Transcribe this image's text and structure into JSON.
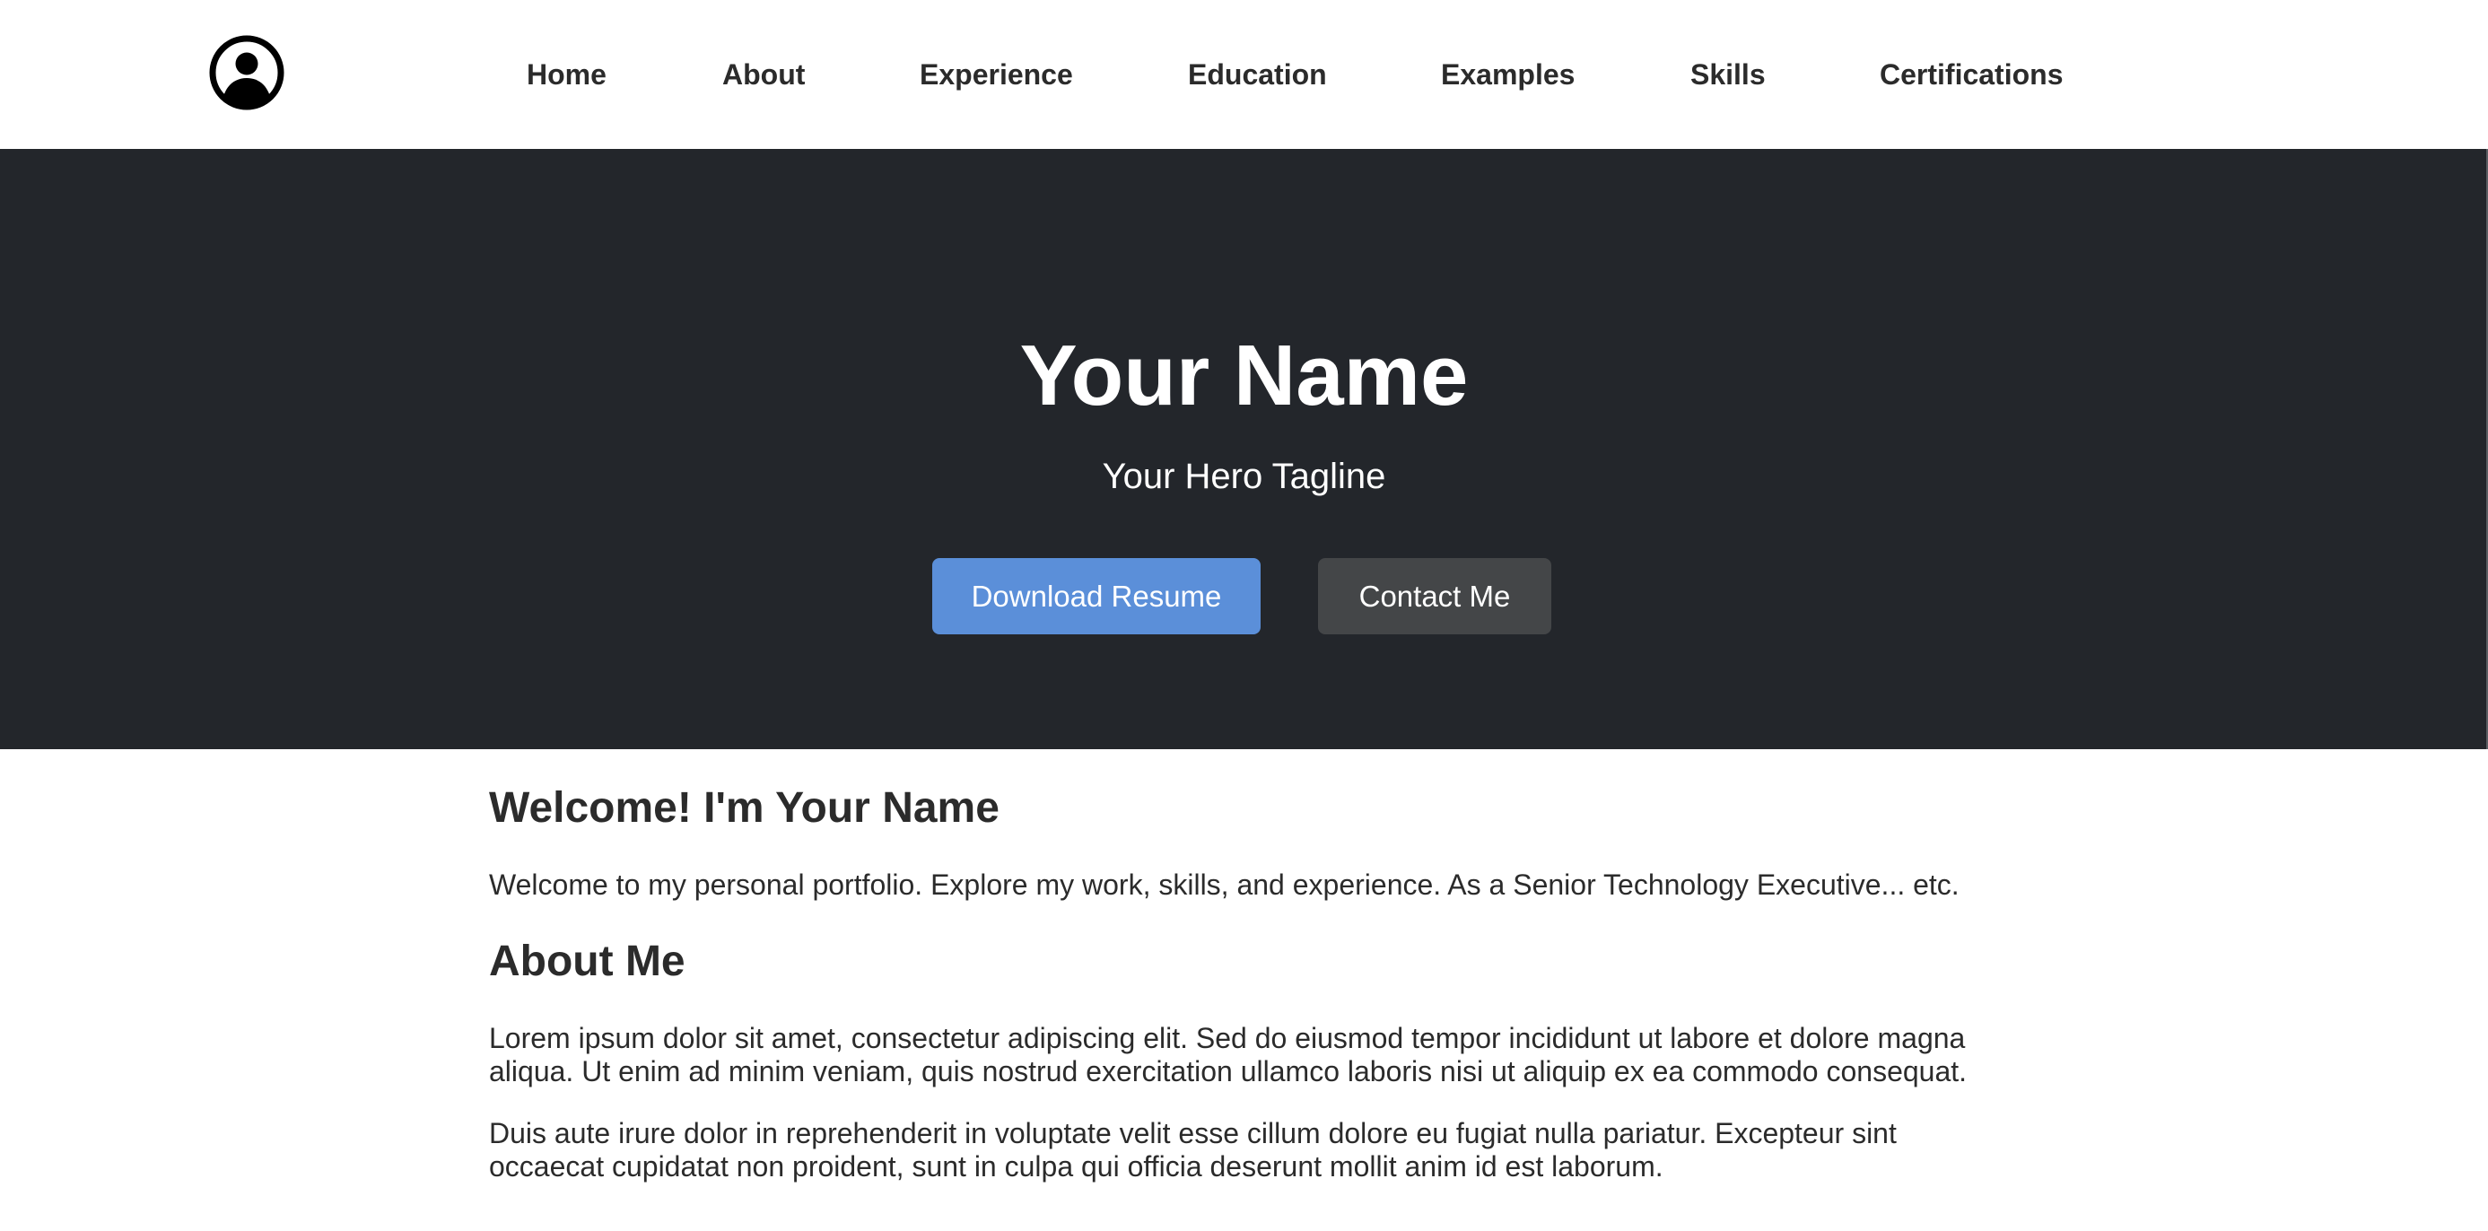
{
  "nav": {
    "logo_icon": "user-avatar-icon",
    "items": [
      {
        "label": "Home"
      },
      {
        "label": "About"
      },
      {
        "label": "Experience"
      },
      {
        "label": "Education"
      },
      {
        "label": "Examples"
      },
      {
        "label": "Skills"
      },
      {
        "label": "Certifications"
      }
    ]
  },
  "hero": {
    "title": "Your Name",
    "tagline": "Your Hero Tagline",
    "primary_button": "Download Resume",
    "secondary_button": "Contact Me"
  },
  "welcome": {
    "heading": "Welcome! I'm Your Name",
    "text": "Welcome to my personal portfolio. Explore my work, skills, and experience. As a Senior Technology Executive... etc."
  },
  "about": {
    "heading": "About Me",
    "paragraphs": [
      "Lorem ipsum dolor sit amet, consectetur adipiscing elit. Sed do eiusmod tempor incididunt ut labore et dolore magna aliqua. Ut enim ad minim veniam, quis nostrud exercitation ullamco laboris nisi ut aliquip ex ea commodo consequat.",
      "Duis aute irure dolor in reprehenderit in voluptate velit esse cillum dolore eu fugiat nulla pariatur. Excepteur sint occaecat cupidatat non proident, sunt in culpa qui officia deserunt mollit anim id est laborum."
    ]
  },
  "colors": {
    "hero_background": "#23262b",
    "primary_button": "#5b8fd9",
    "secondary_button": "#444648",
    "text": "#2b2b2b"
  }
}
